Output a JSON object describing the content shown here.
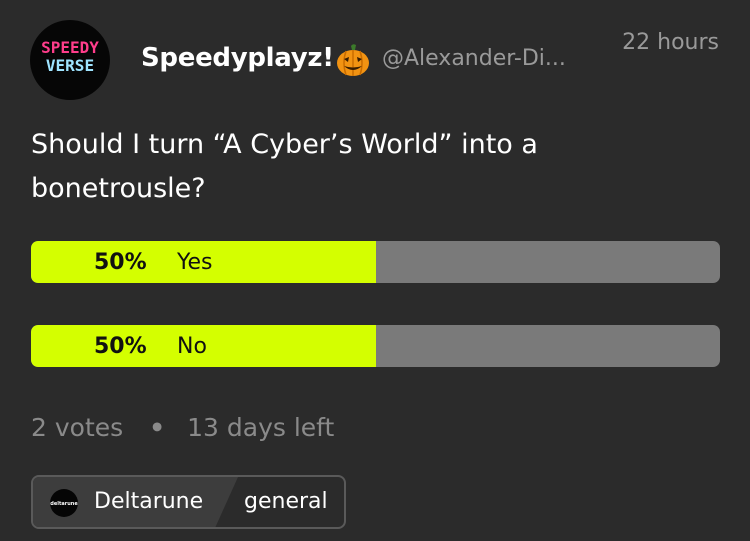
{
  "post": {
    "avatar_text_top": "SPEEDY",
    "avatar_text_bottom": "VERSE",
    "author_name": "Speedyplayz!",
    "author_badge_icon": "jack-o-lantern-icon",
    "author_handle": "@Alexander-Di...",
    "timestamp": "22 hours",
    "question": "Should I turn “A Cyber’s World” into a bonetrousle?"
  },
  "poll": {
    "options": [
      {
        "percent_label": "50%",
        "label": "Yes",
        "fraction": 0.5
      },
      {
        "percent_label": "50%",
        "label": "No",
        "fraction": 0.5
      }
    ],
    "votes": "2 votes",
    "separator": "•",
    "time_left": "13 days left"
  },
  "community": {
    "icon_text": "deltarune",
    "name": "Deltarune",
    "channel": "general"
  },
  "colors": {
    "background": "#2b2b2b",
    "poll_fill": "#d4ff00",
    "poll_track": "#7a7a7a",
    "muted_text": "#9a9a9a",
    "avatar_pink": "#ff3d8b",
    "avatar_cyan": "#9fe4ff"
  }
}
